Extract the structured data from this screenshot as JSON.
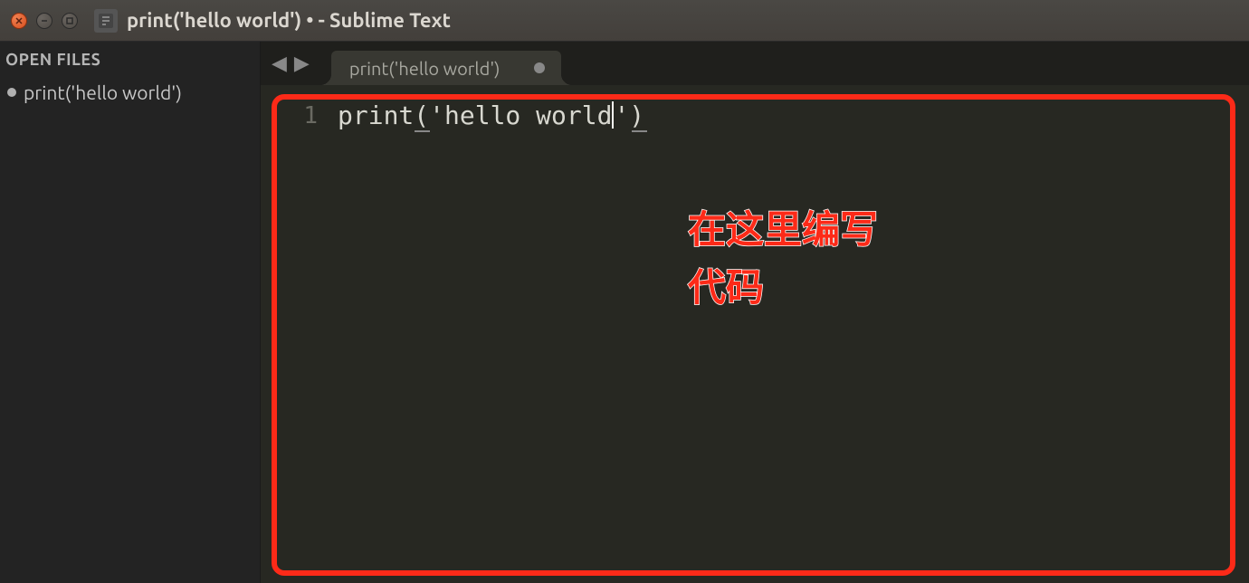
{
  "titlebar": {
    "title": "print('hello world') • - Sublime Text"
  },
  "sidebar": {
    "header": "OPEN FILES",
    "items": [
      {
        "label": "print('hello world')",
        "dirty": true
      }
    ]
  },
  "tabs": [
    {
      "label": "print('hello world')",
      "dirty": true,
      "active": true
    }
  ],
  "editor": {
    "lines": [
      {
        "number": "1",
        "text": "print('hello world')"
      }
    ]
  },
  "annotation": {
    "line1": "在这里编写",
    "line2": "代码"
  }
}
